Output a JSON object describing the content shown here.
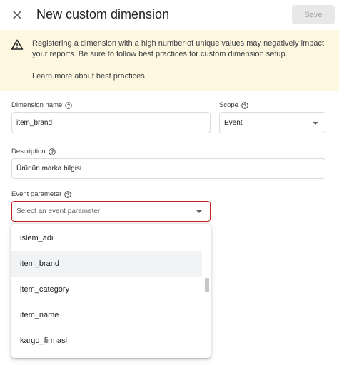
{
  "header": {
    "title": "New custom dimension",
    "save_label": "Save"
  },
  "banner": {
    "message": "Registering a dimension with a high number of unique values may negatively impact your reports. Be sure to follow best practices for custom dimension setup.",
    "link_label": "Learn more about best practices"
  },
  "form": {
    "dimension_name": {
      "label": "Dimension name",
      "value": "item_brand"
    },
    "scope": {
      "label": "Scope",
      "value": "Event"
    },
    "description": {
      "label": "Description",
      "value": "Ürünün marka bilgisi"
    },
    "event_parameter": {
      "label": "Event parameter",
      "placeholder": "Select an event parameter"
    }
  },
  "dropdown": {
    "options": [
      "islem_adi",
      "item_brand",
      "item_category",
      "item_name",
      "kargo_firmasi"
    ],
    "hovered": "item_brand"
  },
  "colors": {
    "banner_bg": "#fef7e0",
    "error_border": "#c5221f",
    "disabled_button": "#e8e8e8"
  },
  "icons": {
    "close": "close-icon",
    "warning": "warning-icon",
    "help": "help-circle-icon",
    "dropdown": "chevron-down-icon"
  }
}
